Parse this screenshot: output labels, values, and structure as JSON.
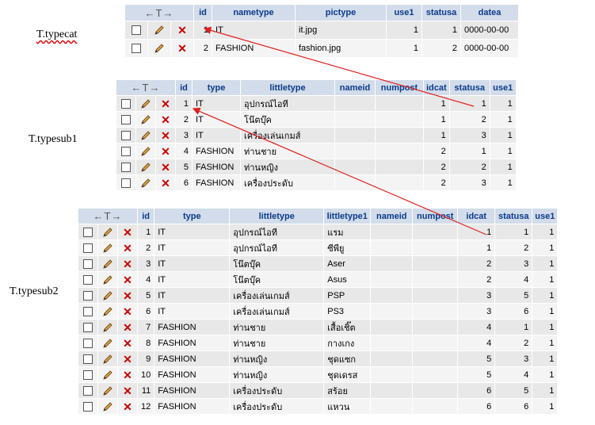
{
  "labels": {
    "typecat": "T.typecat",
    "typesub1": "T.typesub1",
    "typesub2": "T.typesub2"
  },
  "controls": {
    "sort_arrows": "←T→",
    "delete_glyph": "✕"
  },
  "typecat": {
    "headers": [
      "id",
      "nametype",
      "pictype",
      "use1",
      "statusa",
      "datea"
    ],
    "rows": [
      [
        "1",
        "IT",
        "it.jpg",
        "1",
        "1",
        "0000-00-00"
      ],
      [
        "2",
        "FASHION",
        "fashion.jpg",
        "1",
        "2",
        "0000-00-00"
      ]
    ]
  },
  "typesub1": {
    "headers": [
      "id",
      "type",
      "littletype",
      "nameid",
      "numpost",
      "idcat",
      "statusa",
      "use1"
    ],
    "rows": [
      [
        "1",
        "IT",
        "อุปกรณ์ไอที",
        "",
        "",
        "1",
        "1",
        "1"
      ],
      [
        "2",
        "IT",
        "โน๊ตบุ๊ค",
        "",
        "",
        "1",
        "2",
        "1"
      ],
      [
        "3",
        "IT",
        "เครื่องเล่นเกมส์",
        "",
        "",
        "1",
        "3",
        "1"
      ],
      [
        "4",
        "FASHION",
        "ท่านชาย",
        "",
        "",
        "2",
        "1",
        "1"
      ],
      [
        "5",
        "FASHION",
        "ท่านหญิง",
        "",
        "",
        "2",
        "2",
        "1"
      ],
      [
        "6",
        "FASHION",
        "เครื่องประดับ",
        "",
        "",
        "2",
        "3",
        "1"
      ]
    ]
  },
  "typesub2": {
    "headers": [
      "id",
      "type",
      "littletype",
      "littletype1",
      "nameid",
      "numpost",
      "idcat",
      "statusa",
      "use1"
    ],
    "rows": [
      [
        "1",
        "IT",
        "อุปกรณ์ไอที",
        "แรม",
        "",
        "",
        "1",
        "1",
        "1"
      ],
      [
        "2",
        "IT",
        "อุปกรณ์ไอที",
        "ซีพียู",
        "",
        "",
        "1",
        "2",
        "1"
      ],
      [
        "3",
        "IT",
        "โน๊ตบุ๊ค",
        "Aser",
        "",
        "",
        "2",
        "3",
        "1"
      ],
      [
        "4",
        "IT",
        "โน๊ตบุ๊ค",
        "Asus",
        "",
        "",
        "2",
        "4",
        "1"
      ],
      [
        "5",
        "IT",
        "เครื่องเล่นเกมส์",
        "PSP",
        "",
        "",
        "3",
        "5",
        "1"
      ],
      [
        "6",
        "IT",
        "เครื่องเล่นเกมส์",
        "PS3",
        "",
        "",
        "3",
        "6",
        "1"
      ],
      [
        "7",
        "FASHION",
        "ท่านชาย",
        "เสื้อเชิ๊ต",
        "",
        "",
        "4",
        "1",
        "1"
      ],
      [
        "8",
        "FASHION",
        "ท่านชาย",
        "กางเกง",
        "",
        "",
        "4",
        "2",
        "1"
      ],
      [
        "9",
        "FASHION",
        "ท่านหญิง",
        "ชุดแซก",
        "",
        "",
        "5",
        "3",
        "1"
      ],
      [
        "10",
        "FASHION",
        "ท่านหญิง",
        "ชุดเดรส",
        "",
        "",
        "5",
        "4",
        "1"
      ],
      [
        "11",
        "FASHION",
        "เครื่องประดับ",
        "สร้อย",
        "",
        "",
        "6",
        "5",
        "1"
      ],
      [
        "12",
        "FASHION",
        "เครื่องประดับ",
        "แหวน",
        "",
        "",
        "6",
        "6",
        "1"
      ]
    ]
  },
  "colors": {
    "header_bg": "#d2dcea",
    "header_text": "#0b3a8a",
    "row_bg": "#e8e8e8",
    "row_alt_bg": "#f4f4f4",
    "delete": "#cc0000",
    "arrow": "#e02020"
  }
}
